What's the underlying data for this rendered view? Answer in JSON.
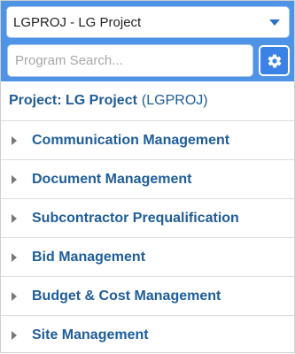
{
  "project_select": {
    "value": "LGPROJ - LG Project"
  },
  "search": {
    "placeholder": "Program Search..."
  },
  "settings": {
    "icon": "gear-icon"
  },
  "project_header": {
    "label": "Project: LG Project",
    "code": "(LGPROJ)"
  },
  "menu": {
    "items": [
      {
        "label": "Communication Management"
      },
      {
        "label": "Document Management"
      },
      {
        "label": "Subcontractor Prequalification"
      },
      {
        "label": "Bid Management"
      },
      {
        "label": "Budget & Cost Management"
      },
      {
        "label": "Site Management"
      }
    ]
  },
  "colors": {
    "header_bar": "#4f93e6",
    "settings_button": "#3b82e6",
    "link_text": "#1f5d99"
  }
}
